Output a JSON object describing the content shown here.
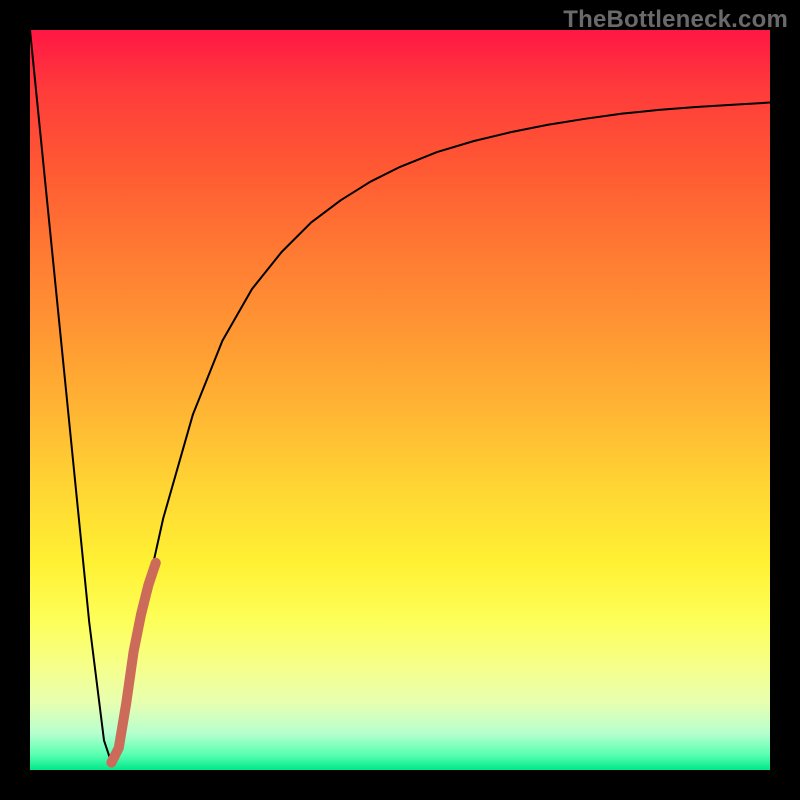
{
  "watermark": "TheBottleneck.com",
  "chart_data": {
    "type": "line",
    "title": "",
    "xlabel": "",
    "ylabel": "",
    "xlim": [
      0,
      100
    ],
    "ylim": [
      0,
      100
    ],
    "grid": false,
    "legend": false,
    "series": [
      {
        "name": "bottleneck-v-curve",
        "color": "#000000",
        "width": 2.0,
        "x": [
          0,
          4,
          8,
          10,
          11,
          12,
          14,
          18,
          22,
          26,
          30,
          34,
          38,
          42,
          46,
          50,
          55,
          60,
          65,
          70,
          75,
          80,
          85,
          90,
          95,
          100
        ],
        "values": [
          100,
          60,
          20,
          4,
          1,
          3,
          16,
          34,
          48,
          58,
          65,
          70,
          74,
          77,
          79.5,
          81.5,
          83.5,
          85,
          86.2,
          87.2,
          88,
          88.7,
          89.2,
          89.6,
          89.9,
          90.2
        ]
      },
      {
        "name": "highlight-segment",
        "color": "#cc6b5a",
        "width": 10,
        "x": [
          11,
          12,
          13,
          14,
          15,
          16,
          17
        ],
        "values": [
          1,
          3,
          9,
          16,
          21,
          25,
          28
        ]
      }
    ]
  }
}
